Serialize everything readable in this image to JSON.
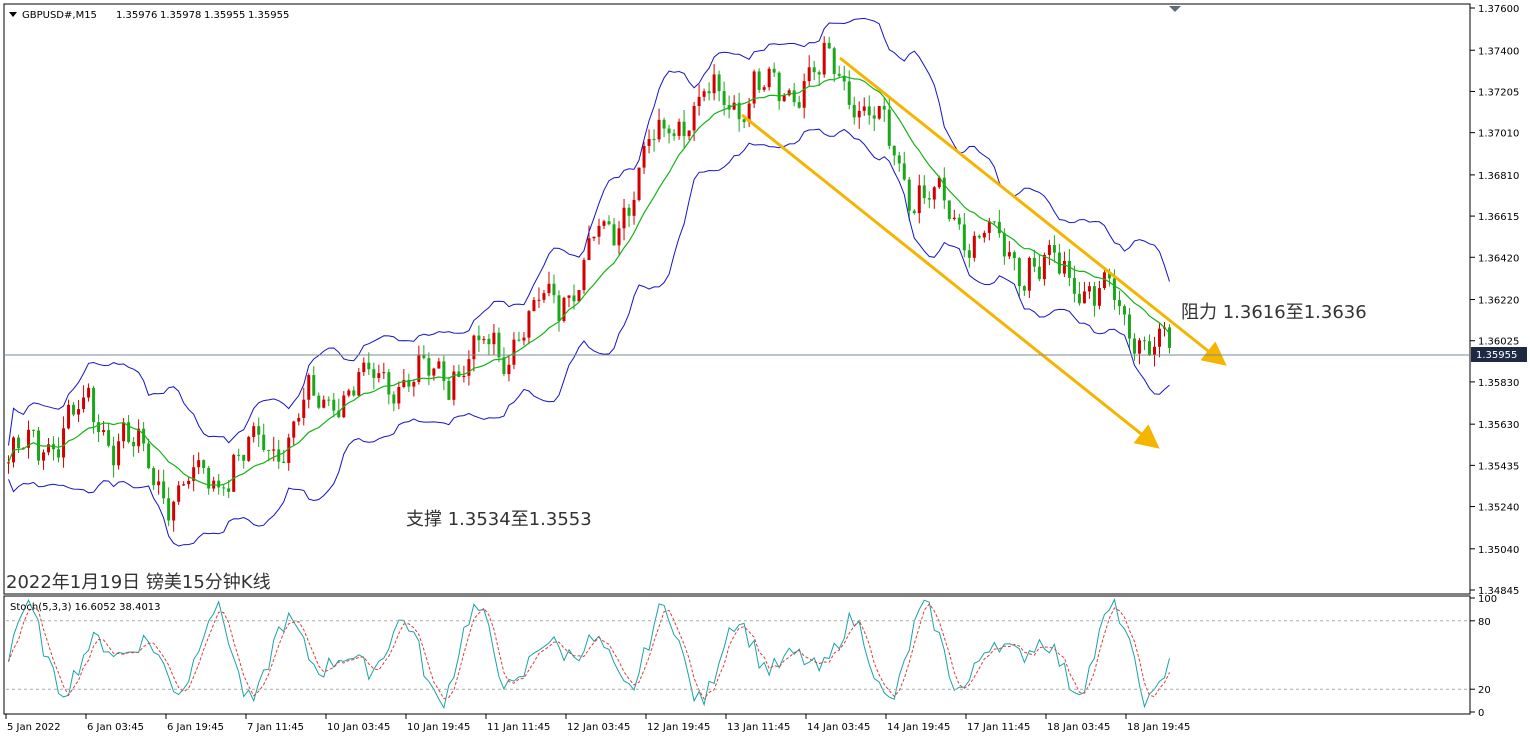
{
  "symbol_info": {
    "symbol": "GBPUSD#,M15",
    "open": "1.35976",
    "high": "1.35978",
    "low": "1.35955",
    "close": "1.35955"
  },
  "price_axis": {
    "ticks": [
      "1.37600",
      "1.37400",
      "1.37205",
      "1.37010",
      "1.36810",
      "1.36615",
      "1.36420",
      "1.36220",
      "1.36025",
      "1.35830",
      "1.35630",
      "1.35435",
      "1.35240",
      "1.35040",
      "1.34845"
    ],
    "current_price": "1.35955"
  },
  "time_axis": {
    "ticks": [
      "5 Jan 2022",
      "6 Jan 03:45",
      "6 Jan 19:45",
      "7 Jan 11:45",
      "10 Jan 03:45",
      "10 Jan 19:45",
      "11 Jan 11:45",
      "12 Jan 03:45",
      "12 Jan 19:45",
      "13 Jan 11:45",
      "14 Jan 03:45",
      "14 Jan 19:45",
      "17 Jan 11:45",
      "18 Jan 03:45",
      "18 Jan 19:45"
    ]
  },
  "annotations": {
    "support": "支撑 1.3534至1.3553",
    "resistance": "阻力 1.3616至1.3636",
    "chart_caption": "2022年1月19日 镑美15分钟K线"
  },
  "stoch": {
    "label": "Stoch(5,3,3) 16.6052 38.4013",
    "ticks": [
      "100",
      "80",
      "20",
      "0"
    ]
  },
  "colors": {
    "bull": "#d40000",
    "bear": "#1aa81a",
    "bands": "#1414c8",
    "ma": "#14b414",
    "channel": "#f5b400",
    "stoch_main": "#1aa3a3",
    "stoch_signal": "#e03c3c",
    "price_label_bg": "#1e2a44"
  },
  "chart_data": {
    "type": "line",
    "title": "GBPUSD#,M15",
    "ylim": [
      1.34845,
      1.376
    ],
    "x": [
      "5 Jan 2022",
      "6 Jan 03:45",
      "6 Jan 19:45",
      "7 Jan 11:45",
      "10 Jan 03:45",
      "10 Jan 19:45",
      "11 Jan 11:45",
      "12 Jan 03:45",
      "12 Jan 19:45",
      "13 Jan 11:45",
      "14 Jan 03:45",
      "14 Jan 19:45",
      "17 Jan 11:45",
      "18 Jan 03:45",
      "18 Jan 19:45"
    ],
    "series": [
      {
        "values": [
          1.3545,
          1.357,
          1.353,
          1.355,
          1.358,
          1.3585,
          1.36,
          1.364,
          1.371,
          1.372,
          1.373,
          1.367,
          1.3645,
          1.363,
          1.3596
        ]
      }
    ],
    "stoch_ylim": [
      0,
      100
    ],
    "stoch_levels": [
      80,
      20
    ],
    "stoch_last": [
      16.6052,
      38.4013
    ]
  }
}
